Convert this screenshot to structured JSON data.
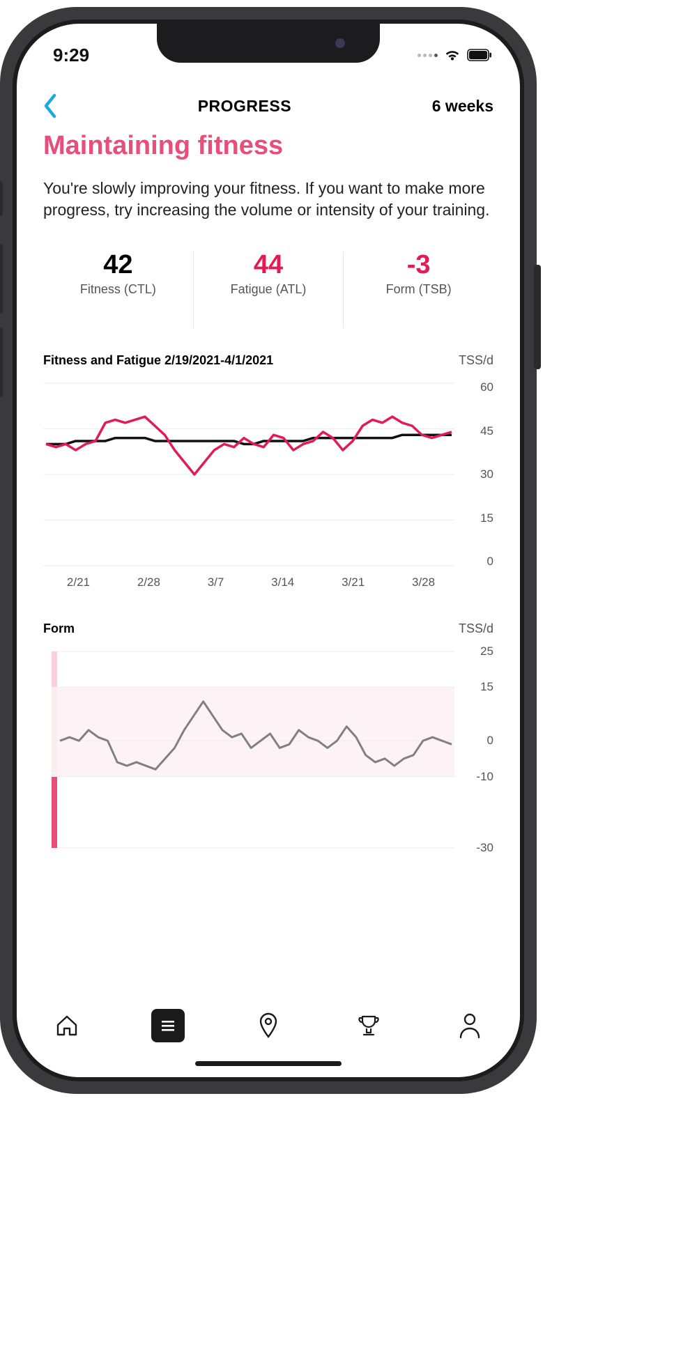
{
  "status": {
    "time": "9:29"
  },
  "nav": {
    "page_title": "PROGRESS",
    "range": "6 weeks"
  },
  "heading": "Maintaining fitness",
  "description": "You're slowly improving your fitness. If you want to make more progress, try increasing the volume or intensity of your training.",
  "metrics": {
    "fitness": {
      "value": "42",
      "label": "Fitness (CTL)"
    },
    "fatigue": {
      "value": "44",
      "label": "Fatigue (ATL)"
    },
    "form": {
      "value": "-3",
      "label": "Form (TSB)"
    }
  },
  "chart1": {
    "title": "Fitness and Fatigue 2/19/2021-4/1/2021",
    "unit": "TSS/d",
    "y_ticks": [
      "60",
      "45",
      "30",
      "15",
      "0"
    ],
    "x_ticks": [
      "2/21",
      "2/28",
      "3/7",
      "3/14",
      "3/21",
      "3/28"
    ]
  },
  "chart2": {
    "title": "Form",
    "unit": "TSS/d",
    "y_ticks": {
      "t25": "25",
      "t15": "15",
      "t0": "0",
      "tn10": "-10",
      "tn30": "-30"
    }
  },
  "chart_data": [
    {
      "type": "line",
      "title": "Fitness and Fatigue 2/19/2021-4/1/2021",
      "xlabel": "",
      "ylabel": "TSS/d",
      "ylim": [
        0,
        60
      ],
      "x_categories": [
        "2/21",
        "2/28",
        "3/7",
        "3/14",
        "3/21",
        "3/28"
      ],
      "series": [
        {
          "name": "Fitness (CTL)",
          "color": "#111111",
          "values": [
            40,
            40,
            40,
            41,
            41,
            41,
            41,
            42,
            42,
            42,
            42,
            41,
            41,
            41,
            41,
            41,
            41,
            41,
            41,
            41,
            40,
            40,
            41,
            41,
            41,
            41,
            41,
            42,
            42,
            42,
            42,
            42,
            42,
            42,
            42,
            42,
            43,
            43,
            43,
            43,
            43,
            43
          ]
        },
        {
          "name": "Fatigue (ATL)",
          "color": "#e31b55",
          "values": [
            40,
            39,
            40,
            38,
            40,
            41,
            47,
            48,
            47,
            48,
            49,
            46,
            43,
            38,
            34,
            30,
            34,
            38,
            40,
            39,
            42,
            40,
            39,
            43,
            42,
            38,
            40,
            41,
            44,
            42,
            38,
            41,
            46,
            48,
            47,
            49,
            47,
            46,
            43,
            42,
            43,
            44
          ]
        }
      ]
    },
    {
      "type": "line",
      "title": "Form",
      "xlabel": "",
      "ylabel": "TSS/d",
      "ylim": [
        -30,
        25
      ],
      "series": [
        {
          "name": "Form (TSB)",
          "color": "#808080",
          "values": [
            0,
            1,
            0,
            3,
            1,
            0,
            -6,
            -7,
            -6,
            -7,
            -8,
            -5,
            -2,
            3,
            7,
            11,
            7,
            3,
            1,
            2,
            -2,
            0,
            2,
            -2,
            -1,
            3,
            1,
            0,
            -2,
            0,
            4,
            1,
            -4,
            -6,
            -5,
            -7,
            -5,
            -4,
            0,
            1,
            0,
            -1
          ]
        }
      ],
      "bands": [
        {
          "from": 15,
          "to": 25,
          "color": "#f9d0db"
        },
        {
          "from": -10,
          "to": 15,
          "color": "#fcedf1"
        },
        {
          "from": -30,
          "to": -10,
          "color": "#e94d7a"
        }
      ]
    }
  ],
  "colors": {
    "accent": "#e31b55",
    "heading": "#e94d7a",
    "back_chevron": "#1aa9e0"
  }
}
